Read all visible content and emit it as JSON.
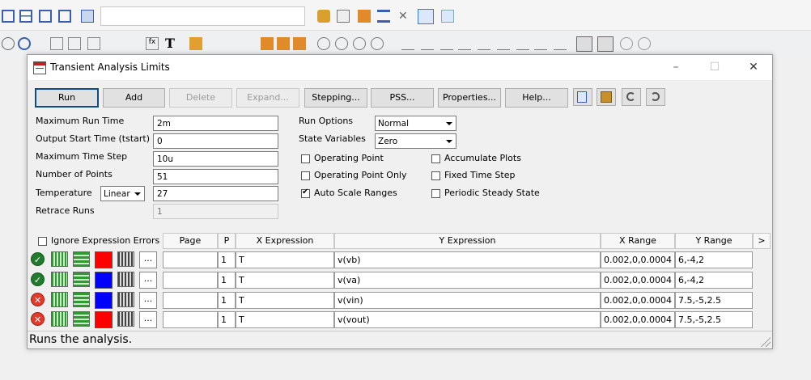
{
  "dialog": {
    "title": "Transient Analysis Limits",
    "buttons": {
      "run": "Run",
      "add": "Add",
      "delete": "Delete",
      "expand": "Expand...",
      "stepping": "Stepping...",
      "pss": "PSS...",
      "properties": "Properties...",
      "help": "Help..."
    },
    "fields": {
      "max_run_time_label": "Maximum Run Time",
      "max_run_time": "2m",
      "output_start_label": "Output Start Time (tstart)",
      "output_start": "0",
      "max_time_step_label": "Maximum Time Step",
      "max_time_step": "10u",
      "num_points_label": "Number of Points",
      "num_points": "51",
      "temperature_label": "Temperature",
      "temperature_mode": "Linear",
      "temperature": "27",
      "retrace_label": "Retrace Runs",
      "retrace": "1"
    },
    "options": {
      "run_options_label": "Run Options",
      "run_options": "Normal",
      "state_variables_label": "State Variables",
      "state_variables": "Zero",
      "operating_point": "Operating Point",
      "operating_point_only": "Operating Point Only",
      "auto_scale": "Auto Scale Ranges",
      "accumulate_plots": "Accumulate Plots",
      "fixed_time_step": "Fixed Time Step",
      "periodic_steady_state": "Periodic Steady State"
    },
    "checks": {
      "operating_point": false,
      "operating_point_only": false,
      "auto_scale": true,
      "accumulate_plots": false,
      "fixed_time_step": false,
      "periodic_steady_state": false,
      "ignore_expression_errors": false
    },
    "grid": {
      "ignore_errors_label": "Ignore Expression Errors",
      "headers": {
        "page": "Page",
        "p": "P",
        "x_expr": "X Expression",
        "y_expr": "Y Expression",
        "x_range": "X Range",
        "y_range": "Y Range",
        "more": ">"
      },
      "rows": [
        {
          "status": "ok",
          "color": "#ff0000",
          "dots": "...",
          "page": "",
          "p": "1",
          "x": "T",
          "y": "v(vb)",
          "xr": "0.002,0,0.0004",
          "yr": "6,-4,2"
        },
        {
          "status": "ok",
          "color": "#0000ff",
          "dots": "...",
          "page": "",
          "p": "1",
          "x": "T",
          "y": "v(va)",
          "xr": "0.002,0,0.0004",
          "yr": "6,-4,2"
        },
        {
          "status": "err",
          "color": "#0000ff",
          "dots": "...",
          "page": "",
          "p": "1",
          "x": "T",
          "y": "v(vin)",
          "xr": "0.002,0,0.0004",
          "yr": "7.5,-5,2.5"
        },
        {
          "status": "err",
          "color": "#ff0000",
          "dots": "...",
          "page": "",
          "p": "1",
          "x": "T",
          "y": "v(vout)",
          "xr": "0.002,0,0.0004",
          "yr": "7.5,-5,2.5"
        }
      ]
    },
    "status_text": "Runs the analysis.",
    "window_controls": {
      "minimize": "–",
      "maximize": "☐",
      "close": "✕"
    }
  },
  "colors": {
    "ok": "#217a2e",
    "error": "#e23b2a",
    "grid_icon": "#2e9b2e"
  },
  "app_toolbar_glyphs": {
    "text_tool": "T"
  }
}
